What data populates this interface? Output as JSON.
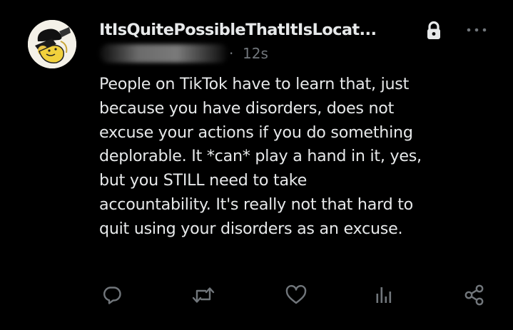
{
  "author": {
    "display_name": "ItIsQuitePossibleThatItIsLocat...",
    "protected": true,
    "avatar": "cartoon-face-avatar"
  },
  "meta": {
    "separator": "·",
    "timestamp": "12s"
  },
  "body": {
    "lines": [
      "People on TikTok have to learn that, just",
      "because you have disorders, does not",
      "excuse your actions if you do something",
      "deplorable. It *can* play a hand in it, yes,",
      "but you STILL need to take",
      "accountability. It's really not that hard to",
      "quit using your disorders as an excuse."
    ]
  },
  "actions": [
    {
      "name": "reply",
      "icon": "reply-icon"
    },
    {
      "name": "repost",
      "icon": "repost-icon"
    },
    {
      "name": "like",
      "icon": "heart-icon"
    },
    {
      "name": "views",
      "icon": "analytics-icon"
    },
    {
      "name": "share",
      "icon": "share-icon"
    }
  ],
  "colors": {
    "background": "#000000",
    "primary_text": "#e7e9ea",
    "secondary_text": "#71767b"
  }
}
